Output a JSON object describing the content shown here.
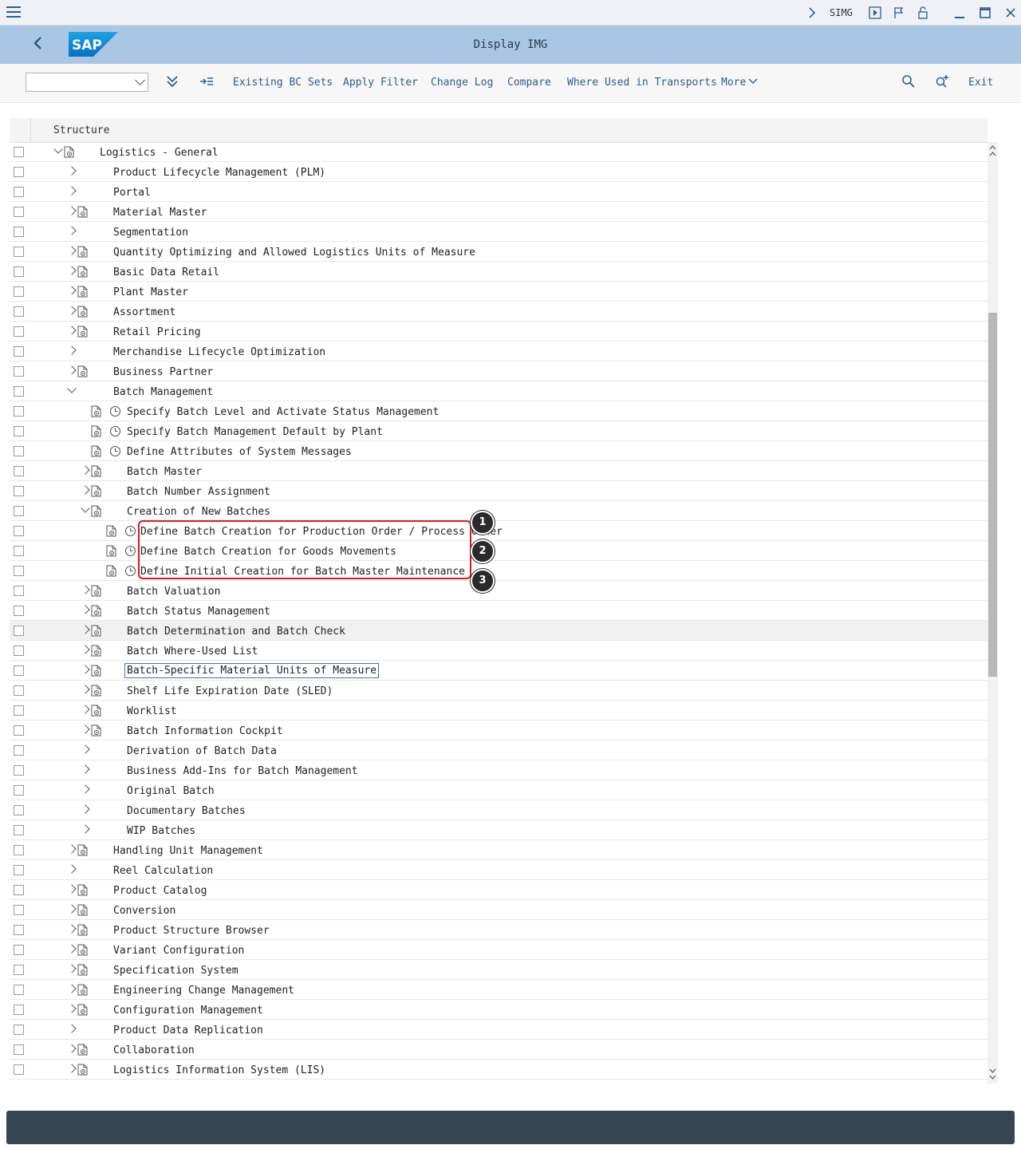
{
  "topbar": {
    "tcode": "SIMG"
  },
  "titlebar": {
    "title": "Display IMG",
    "logo": "SAP"
  },
  "toolbar": {
    "variant_value": "",
    "buttons": [
      "Existing BC Sets",
      "Apply Filter",
      "Change Log",
      "Compare",
      "Where Used in Transports",
      "More"
    ],
    "exit": "Exit"
  },
  "tree": {
    "header": "Structure",
    "rows": [
      {
        "label": "Logistics - General",
        "level": 0,
        "expand": "open",
        "doc": true,
        "clock": false
      },
      {
        "label": "Product Lifecycle Management (PLM)",
        "level": 1,
        "expand": "closed",
        "doc": false,
        "clock": false
      },
      {
        "label": "Portal",
        "level": 1,
        "expand": "closed",
        "doc": false,
        "clock": false
      },
      {
        "label": "Material Master",
        "level": 1,
        "expand": "closed",
        "doc": true,
        "clock": false
      },
      {
        "label": "Segmentation",
        "level": 1,
        "expand": "closed",
        "doc": false,
        "clock": false
      },
      {
        "label": "Quantity Optimizing and Allowed Logistics Units of Measure",
        "level": 1,
        "expand": "closed",
        "doc": true,
        "clock": false
      },
      {
        "label": "Basic Data Retail",
        "level": 1,
        "expand": "closed",
        "doc": true,
        "clock": false
      },
      {
        "label": "Plant Master",
        "level": 1,
        "expand": "closed",
        "doc": true,
        "clock": false
      },
      {
        "label": "Assortment",
        "level": 1,
        "expand": "closed",
        "doc": true,
        "clock": false
      },
      {
        "label": "Retail Pricing",
        "level": 1,
        "expand": "closed",
        "doc": true,
        "clock": false
      },
      {
        "label": "Merchandise Lifecycle Optimization",
        "level": 1,
        "expand": "closed",
        "doc": false,
        "clock": false
      },
      {
        "label": "Business Partner",
        "level": 1,
        "expand": "closed",
        "doc": true,
        "clock": false
      },
      {
        "label": "Batch Management",
        "level": 1,
        "expand": "open",
        "doc": false,
        "clock": false
      },
      {
        "label": "Specify Batch Level and Activate Status Management",
        "level": 2,
        "expand": "none",
        "doc": true,
        "clock": true
      },
      {
        "label": "Specify Batch Management Default by Plant",
        "level": 2,
        "expand": "none",
        "doc": true,
        "clock": true
      },
      {
        "label": "Define Attributes of System Messages",
        "level": 2,
        "expand": "none",
        "doc": true,
        "clock": true
      },
      {
        "label": "Batch Master",
        "level": 2,
        "expand": "closed",
        "doc": true,
        "clock": false
      },
      {
        "label": "Batch Number Assignment",
        "level": 2,
        "expand": "closed",
        "doc": true,
        "clock": false
      },
      {
        "label": "Creation of New Batches",
        "level": 2,
        "expand": "open",
        "doc": true,
        "clock": false
      },
      {
        "label": "Define Batch Creation for Production Order / Process Order",
        "level": 3,
        "expand": "none",
        "doc": true,
        "clock": true
      },
      {
        "label": "Define Batch Creation for Goods Movements",
        "level": 3,
        "expand": "none",
        "doc": true,
        "clock": true
      },
      {
        "label": "Define Initial Creation for Batch Master Maintenance",
        "level": 3,
        "expand": "none",
        "doc": true,
        "clock": true
      },
      {
        "label": "Batch Valuation",
        "level": 2,
        "expand": "closed",
        "doc": true,
        "clock": false
      },
      {
        "label": "Batch Status Management",
        "level": 2,
        "expand": "closed",
        "doc": true,
        "clock": false
      },
      {
        "label": "Batch Determination and Batch Check",
        "level": 2,
        "expand": "closed",
        "doc": true,
        "clock": false,
        "highlight": true
      },
      {
        "label": "Batch Where-Used List",
        "level": 2,
        "expand": "closed",
        "doc": true,
        "clock": false
      },
      {
        "label": "Batch-Specific Material Units of Measure",
        "level": 2,
        "expand": "closed",
        "doc": true,
        "clock": false,
        "focus": true
      },
      {
        "label": "Shelf Life Expiration Date (SLED)",
        "level": 2,
        "expand": "closed",
        "doc": true,
        "clock": false
      },
      {
        "label": "Worklist",
        "level": 2,
        "expand": "closed",
        "doc": true,
        "clock": false
      },
      {
        "label": "Batch Information Cockpit",
        "level": 2,
        "expand": "closed",
        "doc": true,
        "clock": false
      },
      {
        "label": "Derivation of Batch Data",
        "level": 2,
        "expand": "closed",
        "doc": false,
        "clock": false
      },
      {
        "label": "Business Add-Ins for Batch Management",
        "level": 2,
        "expand": "closed",
        "doc": false,
        "clock": false
      },
      {
        "label": "Original Batch",
        "level": 2,
        "expand": "closed",
        "doc": false,
        "clock": false
      },
      {
        "label": "Documentary Batches",
        "level": 2,
        "expand": "closed",
        "doc": false,
        "clock": false
      },
      {
        "label": "WIP Batches",
        "level": 2,
        "expand": "closed",
        "doc": false,
        "clock": false
      },
      {
        "label": "Handling Unit Management",
        "level": 1,
        "expand": "closed",
        "doc": true,
        "clock": false
      },
      {
        "label": "Reel Calculation",
        "level": 1,
        "expand": "closed",
        "doc": false,
        "clock": false
      },
      {
        "label": "Product Catalog",
        "level": 1,
        "expand": "closed",
        "doc": true,
        "clock": false
      },
      {
        "label": "Conversion",
        "level": 1,
        "expand": "closed",
        "doc": true,
        "clock": false
      },
      {
        "label": "Product Structure Browser",
        "level": 1,
        "expand": "closed",
        "doc": true,
        "clock": false
      },
      {
        "label": "Variant Configuration",
        "level": 1,
        "expand": "closed",
        "doc": true,
        "clock": false
      },
      {
        "label": "Specification System",
        "level": 1,
        "expand": "closed",
        "doc": true,
        "clock": false
      },
      {
        "label": "Engineering Change Management",
        "level": 1,
        "expand": "closed",
        "doc": true,
        "clock": false
      },
      {
        "label": "Configuration Management",
        "level": 1,
        "expand": "closed",
        "doc": true,
        "clock": false
      },
      {
        "label": "Product Data Replication",
        "level": 1,
        "expand": "closed",
        "doc": false,
        "clock": false
      },
      {
        "label": "Collaboration",
        "level": 1,
        "expand": "closed",
        "doc": true,
        "clock": false
      },
      {
        "label": "Logistics Information System (LIS)",
        "level": 1,
        "expand": "closed",
        "doc": true,
        "clock": false
      }
    ]
  },
  "callouts": [
    "1",
    "2",
    "3"
  ],
  "colors": {
    "titlebar_bg": "#a9c6e3",
    "link": "#2d5d8f",
    "callout_border": "#e01818",
    "statusbar_bg": "#354551"
  },
  "icons": {
    "menu": "hamburger-icon",
    "back": "back-arrow-icon",
    "doc": "img-documentation-icon",
    "clock": "activity-clock-icon",
    "search": "search-icon",
    "find_next": "find-next-icon"
  }
}
